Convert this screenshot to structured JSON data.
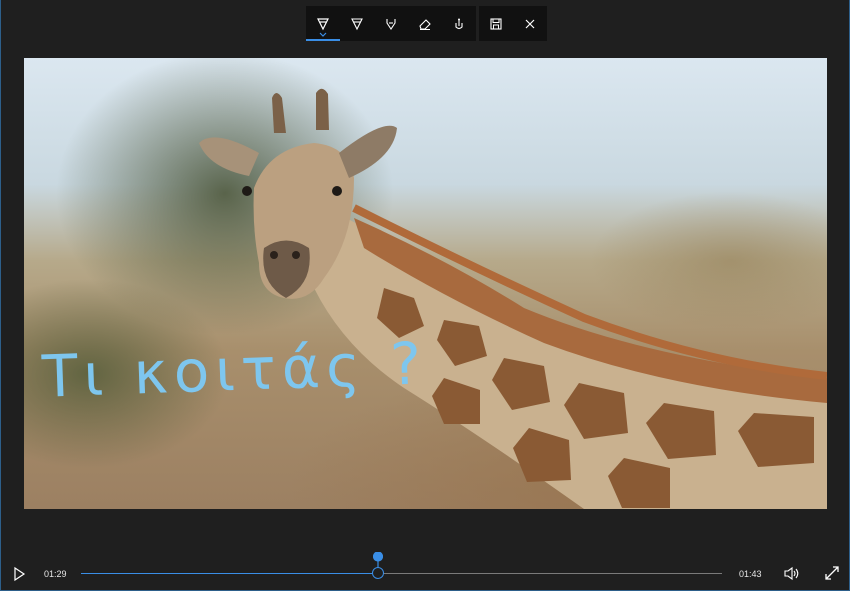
{
  "toolbar": {
    "tools": [
      {
        "name": "ballpoint-pen-icon",
        "active": true
      },
      {
        "name": "pencil-icon",
        "active": false
      },
      {
        "name": "highlighter-icon",
        "active": false
      },
      {
        "name": "eraser-icon",
        "active": false
      },
      {
        "name": "touch-writing-icon",
        "active": false
      }
    ],
    "actions": [
      {
        "name": "save-icon"
      },
      {
        "name": "close-icon"
      }
    ]
  },
  "video": {
    "annotation_text": "Τι κοιτάς ?",
    "annotation_color": "#7ec6ee"
  },
  "player": {
    "current_time": "01:29",
    "duration": "01:43",
    "progress": 0.464,
    "accent_color": "#3a8ee6"
  }
}
